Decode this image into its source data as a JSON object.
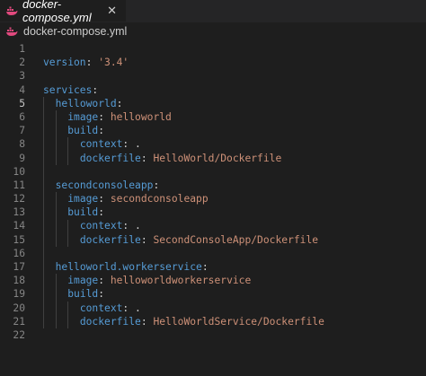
{
  "tab": {
    "label": "docker-compose.yml",
    "close": "✕",
    "icon": "docker-whale-icon",
    "accent": "#e2497e"
  },
  "breadcrumb": {
    "label": "docker-compose.yml",
    "icon": "docker-whale-icon"
  },
  "editor": {
    "active_line": 5,
    "lines": [
      {
        "n": "1",
        "indent": "",
        "key": "",
        "val": "",
        "colon": ""
      },
      {
        "n": "2",
        "indent": "",
        "key": "version",
        "colon": ": ",
        "val": "'3.4'"
      },
      {
        "n": "3",
        "indent": "",
        "key": "",
        "val": "",
        "colon": ""
      },
      {
        "n": "4",
        "indent": "",
        "key": "services",
        "colon": ":",
        "val": ""
      },
      {
        "n": "5",
        "indent": "  ",
        "key": "helloworld",
        "colon": ":",
        "val": ""
      },
      {
        "n": "6",
        "indent": "    ",
        "key": "image",
        "colon": ": ",
        "val": "helloworld"
      },
      {
        "n": "7",
        "indent": "    ",
        "key": "build",
        "colon": ":",
        "val": ""
      },
      {
        "n": "8",
        "indent": "      ",
        "key": "context",
        "colon": ": ",
        "val": "."
      },
      {
        "n": "9",
        "indent": "      ",
        "key": "dockerfile",
        "colon": ": ",
        "val": "HelloWorld/Dockerfile"
      },
      {
        "n": "10",
        "indent": "",
        "key": "",
        "val": "",
        "colon": ""
      },
      {
        "n": "11",
        "indent": "  ",
        "key": "secondconsoleapp",
        "colon": ":",
        "val": ""
      },
      {
        "n": "12",
        "indent": "    ",
        "key": "image",
        "colon": ": ",
        "val": "secondconsoleapp"
      },
      {
        "n": "13",
        "indent": "    ",
        "key": "build",
        "colon": ":",
        "val": ""
      },
      {
        "n": "14",
        "indent": "      ",
        "key": "context",
        "colon": ": ",
        "val": "."
      },
      {
        "n": "15",
        "indent": "      ",
        "key": "dockerfile",
        "colon": ": ",
        "val": "SecondConsoleApp/Dockerfile"
      },
      {
        "n": "16",
        "indent": "",
        "key": "",
        "val": "",
        "colon": ""
      },
      {
        "n": "17",
        "indent": "  ",
        "key": "helloworld.workerservice",
        "colon": ":",
        "val": ""
      },
      {
        "n": "18",
        "indent": "    ",
        "key": "image",
        "colon": ": ",
        "val": "helloworldworkerservice"
      },
      {
        "n": "19",
        "indent": "    ",
        "key": "build",
        "colon": ":",
        "val": ""
      },
      {
        "n": "20",
        "indent": "      ",
        "key": "context",
        "colon": ": ",
        "val": "."
      },
      {
        "n": "21",
        "indent": "      ",
        "key": "dockerfile",
        "colon": ": ",
        "val": "HelloWorldService/Dockerfile"
      },
      {
        "n": "22",
        "indent": "",
        "key": "",
        "val": "",
        "colon": ""
      }
    ]
  },
  "colors": {
    "background": "#1e1e1e",
    "key": "#569cd6",
    "string": "#ce9178",
    "punctuation": "#d4d4d4",
    "line_number": "#858585"
  }
}
